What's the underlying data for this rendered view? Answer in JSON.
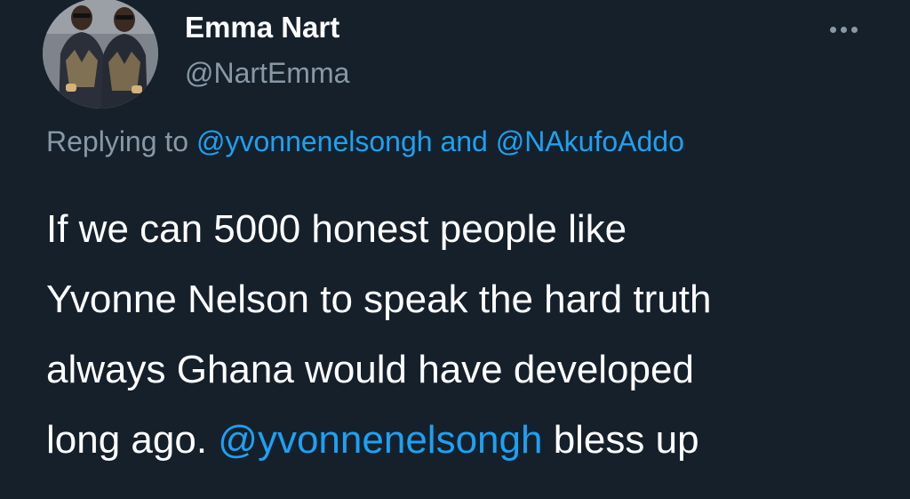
{
  "author": {
    "display_name": "Emma Nart",
    "handle": "@NartEmma",
    "avatar_icon": "profile-photo"
  },
  "more_icon": "more-horizontal-icon",
  "reply": {
    "prefix": "Replying to",
    "mention_1": "@yvonnenelsongh",
    "joiner": "and",
    "mention_2": "@NAkufoAddo"
  },
  "body": {
    "line_1": "If we can 5000 honest people like",
    "line_2": "Yvonne Nelson to speak the hard truth",
    "line_3": "always Ghana would have developed",
    "line_4_prefix": "long ago.",
    "line_4_mention": "@yvonnenelsongh",
    "line_4_suffix": "bless up"
  },
  "colors": {
    "background": "#15202b",
    "text": "#ffffff",
    "secondary": "#8899a6",
    "link": "#1da1f2"
  }
}
